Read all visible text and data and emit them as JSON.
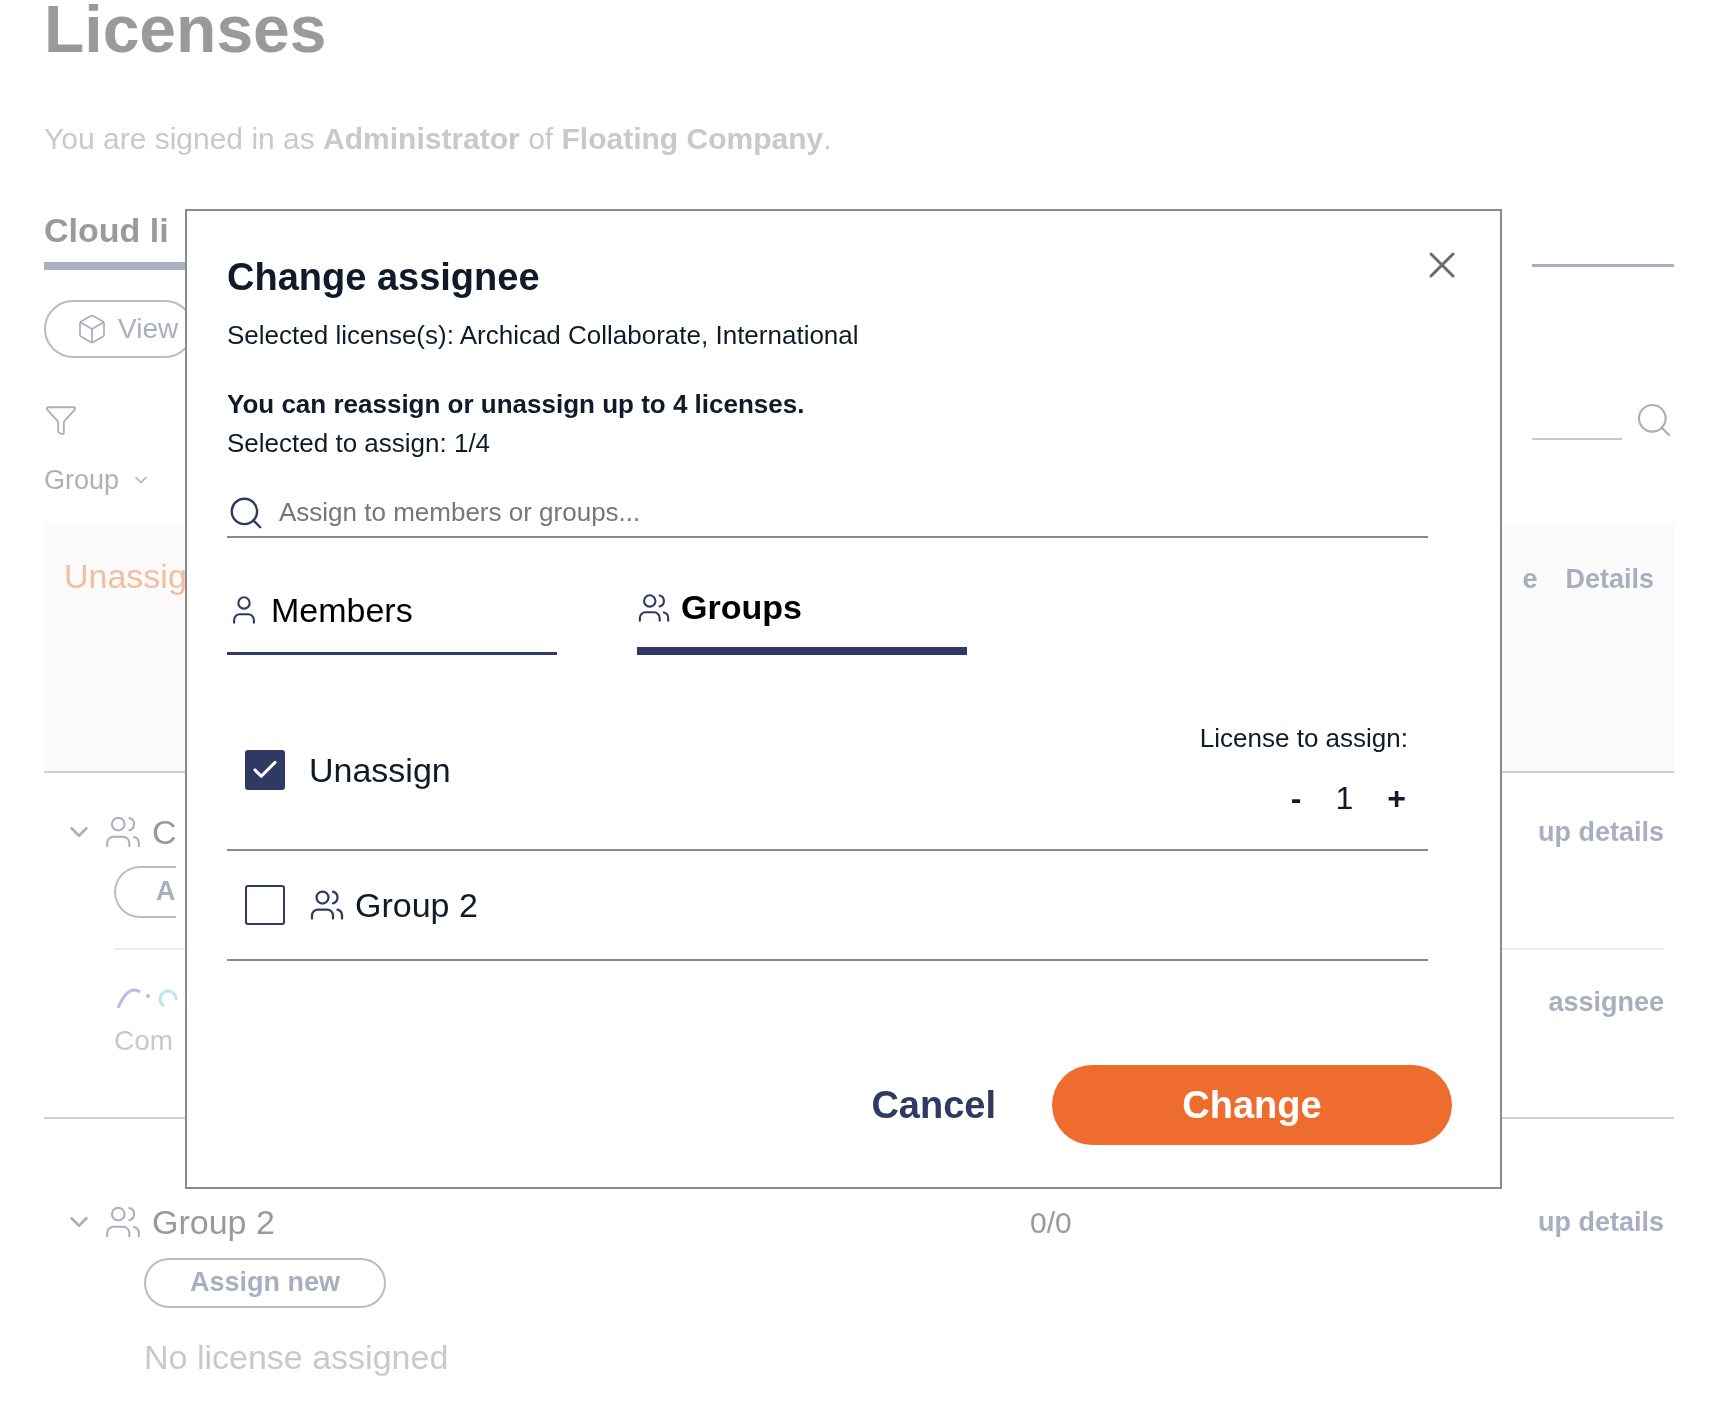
{
  "page": {
    "title": "Licenses",
    "signed_in": "You are signed in as **Administrator** of **Floating Company**."
  },
  "background": {
    "tab_label": "Cloud li",
    "view_button": "View",
    "group_filter": "Group",
    "unassigned_panel": {
      "label": "Unassig",
      "column_partial": "e",
      "details": "Details"
    },
    "groups": [
      {
        "name": "C",
        "button": "A",
        "details_link": "up details",
        "expanded": true,
        "license": {
          "product": "Com",
          "action": "assignee"
        }
      },
      {
        "name": "Group 2",
        "count": "0/0",
        "button": "Assign new",
        "details_link": "up details",
        "expanded": true,
        "empty_text": "No license assigned"
      }
    ]
  },
  "dialog": {
    "title": "Change assignee",
    "selected_licenses": "Selected license(s): Archicad Collaborate, International",
    "limit_note": "You can reassign or unassign up to 4 licenses.",
    "selected_count": "Selected to assign: 1/4",
    "search": {
      "placeholder": "Assign to members or groups..."
    },
    "tabs": [
      {
        "label": "Members",
        "selected": false,
        "kind": "member"
      },
      {
        "label": "Groups",
        "selected": true,
        "kind": "group"
      }
    ],
    "options": [
      {
        "label": "Unassign",
        "checked": true,
        "kind": "plain",
        "quantity": {
          "label": "License to assign:",
          "decrement": "-",
          "value": "1",
          "increment": "+"
        }
      },
      {
        "label": "Group 2",
        "checked": false,
        "kind": "group"
      }
    ],
    "buttons": {
      "cancel": "Cancel",
      "confirm": "Change"
    }
  }
}
